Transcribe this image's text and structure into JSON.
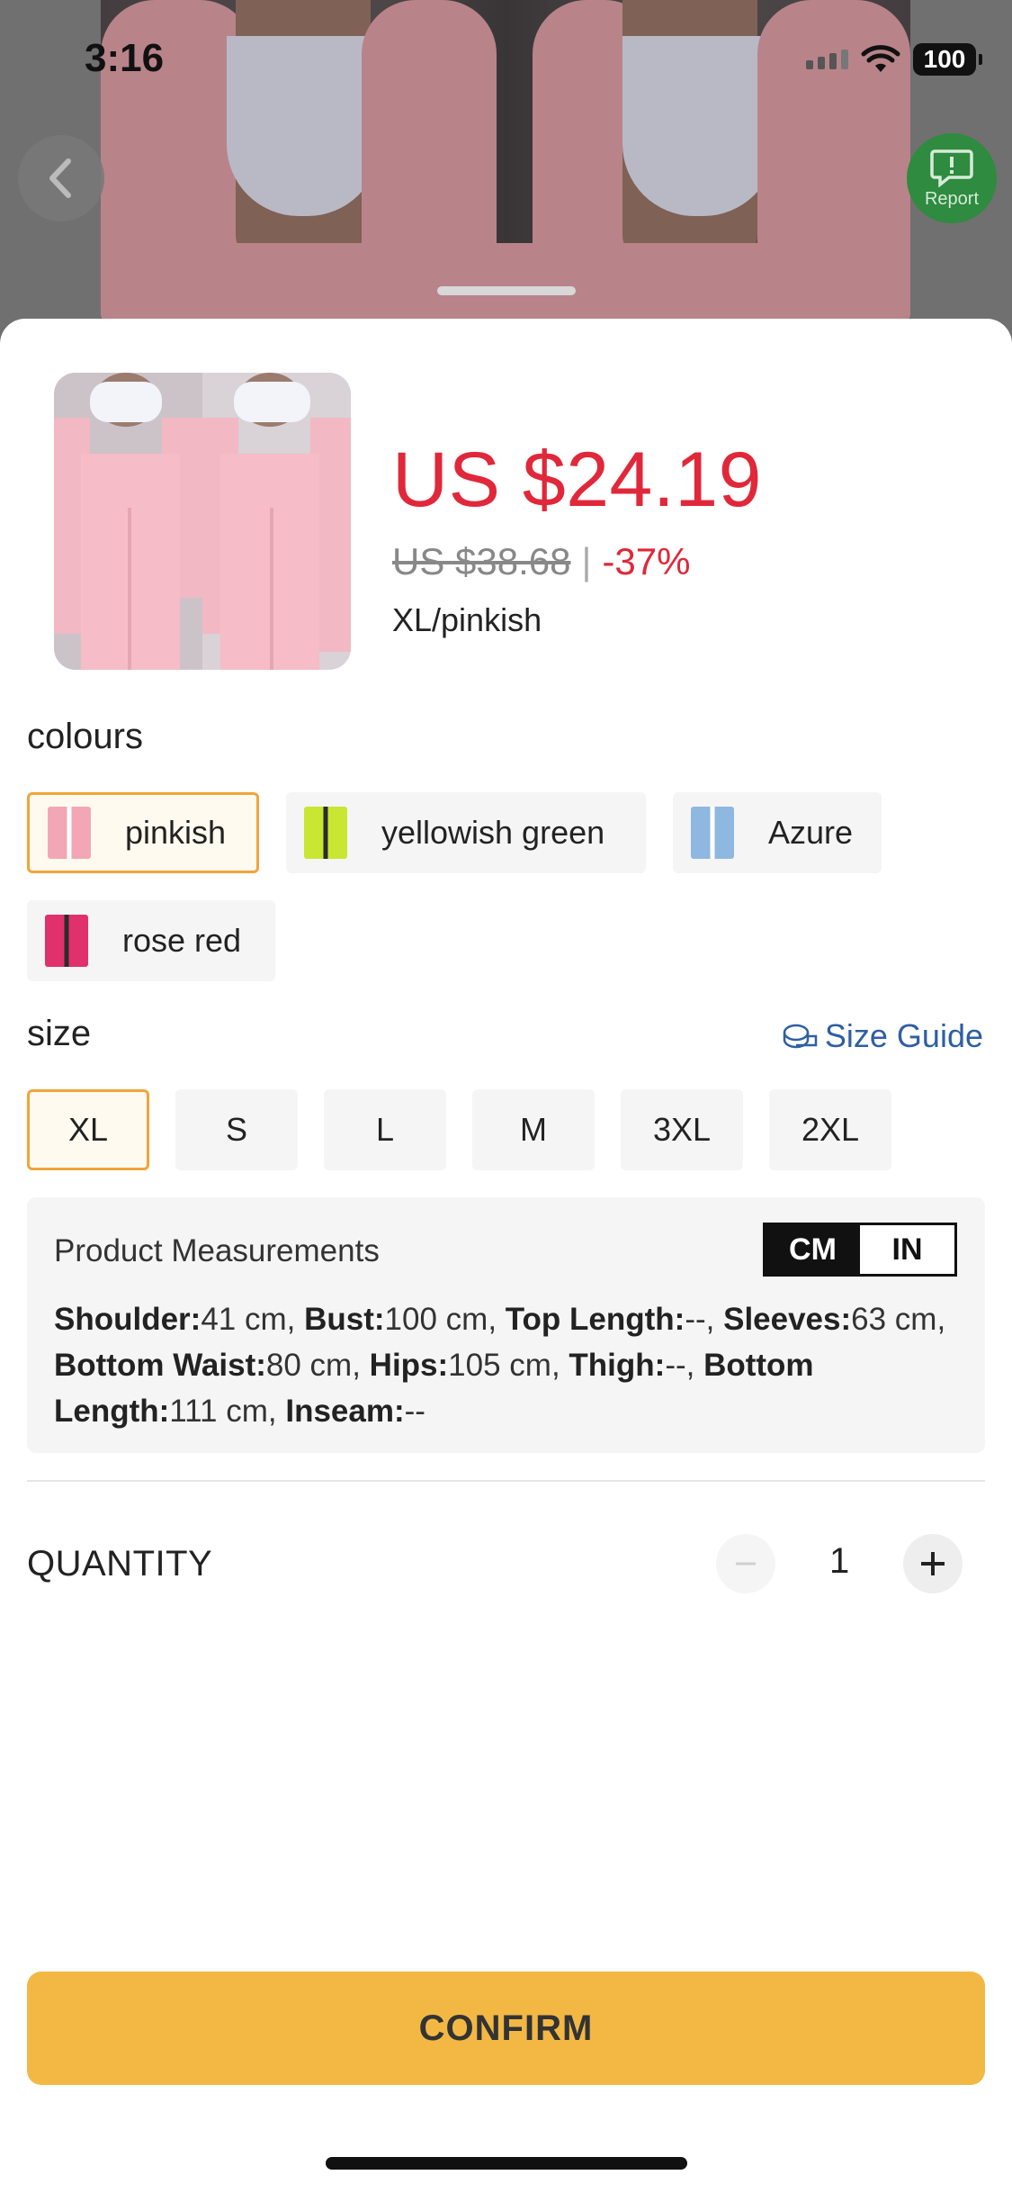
{
  "status_bar": {
    "time": "3:16",
    "battery": "100"
  },
  "report": {
    "label": "Report"
  },
  "product": {
    "price": "US $24.19",
    "original_price": "US $38.68",
    "separator": "|",
    "discount": "-37%",
    "selected_variant": "XL/pinkish"
  },
  "colours": {
    "title": "colours",
    "options": [
      {
        "label": "pinkish",
        "selected": true,
        "swatch": "#f2a7b7"
      },
      {
        "label": "yellowish green",
        "selected": false,
        "swatch": "#c9e631"
      },
      {
        "label": "Azure",
        "selected": false,
        "swatch": "#8fb8e0"
      },
      {
        "label": "rose red",
        "selected": false,
        "swatch": "#e0316c"
      }
    ]
  },
  "size": {
    "title": "size",
    "guide_label": "Size Guide",
    "options": [
      {
        "label": "XL",
        "selected": true
      },
      {
        "label": "S",
        "selected": false
      },
      {
        "label": "L",
        "selected": false
      },
      {
        "label": "M",
        "selected": false
      },
      {
        "label": "3XL",
        "selected": false
      },
      {
        "label": "2XL",
        "selected": false
      }
    ]
  },
  "measurements": {
    "title": "Product Measurements",
    "unit_cm": "CM",
    "unit_in": "IN",
    "selected_unit": "CM",
    "items": [
      {
        "name": "Shoulder:",
        "value": "41 cm"
      },
      {
        "name": "Bust:",
        "value": "100 cm"
      },
      {
        "name": "Top Length:",
        "value": "--"
      },
      {
        "name": "Sleeves:",
        "value": "63 cm"
      },
      {
        "name": "Bottom Waist:",
        "value": "80 cm"
      },
      {
        "name": "Hips:",
        "value": "105 cm"
      },
      {
        "name": "Thigh:",
        "value": "--"
      },
      {
        "name": "Bottom Length:",
        "value": "111 cm"
      },
      {
        "name": "Inseam:",
        "value": "--"
      }
    ]
  },
  "quantity": {
    "label": "QUANTITY",
    "value": "1"
  },
  "confirm": {
    "label": "CONFIRM"
  },
  "colors": {
    "accent": "#f3b844",
    "price": "#e0283a",
    "selected_border": "#f0a53a",
    "link": "#2e5fa3"
  }
}
